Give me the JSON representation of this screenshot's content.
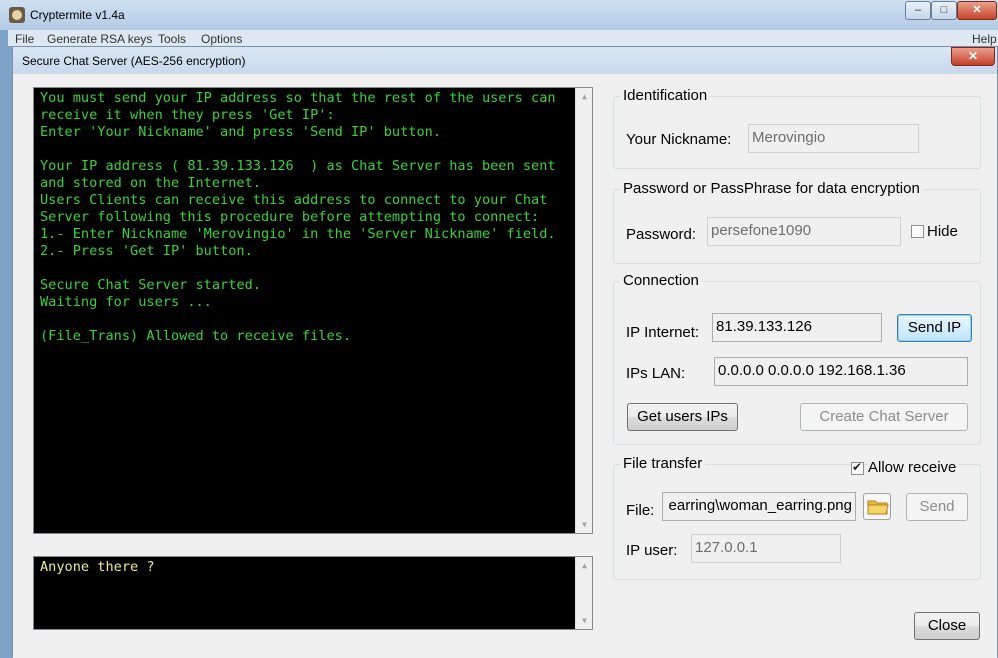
{
  "window": {
    "title": "Cryptermite v1.4a",
    "minimize_glyph": "–",
    "maximize_glyph": "□",
    "close_glyph": "✕"
  },
  "menu": {
    "items": [
      "File",
      "Generate RSA keys",
      "Tools",
      "Options"
    ],
    "help": "Help"
  },
  "dialog": {
    "title": "Secure Chat Server (AES-256 encryption)",
    "close_glyph": "✕"
  },
  "chat_log": {
    "lines": [
      "You must send your IP address so that the rest of the users can",
      "receive it when they press 'Get IP':",
      "Enter 'Your Nickname' and press 'Send IP' button.",
      "",
      "Your IP address ( 81.39.133.126  ) as Chat Server has been sent",
      "and stored on the Internet.",
      "Users Clients can receive this address to connect to your Chat",
      "Server following this procedure before attempting to connect:",
      "1.- Enter Nickname 'Merovingio' in the 'Server Nickname' field.",
      "2.- Press 'Get IP' button.",
      "",
      "Secure Chat Server started.",
      "Waiting for users ...",
      "",
      "(File_Trans) Allowed to receive files."
    ]
  },
  "message_input": {
    "value": "Anyone there ?"
  },
  "identification": {
    "legend": "Identification",
    "nickname_label": "Your Nickname:",
    "nickname_value": "Merovingio"
  },
  "password": {
    "legend": "Password or PassPhrase for data encryption",
    "label": "Password:",
    "value": "persefone1090",
    "hide_label": "Hide",
    "hide_checked": false
  },
  "connection": {
    "legend": "Connection",
    "ip_internet_label": "IP Internet:",
    "ip_internet_value": "81.39.133.126",
    "send_ip_button": "Send IP",
    "ips_lan_label": "IPs LAN:",
    "ips_lan_value": "0.0.0.0  0.0.0.0  192.168.1.36",
    "get_users_ips_button": "Get users IPs",
    "create_chat_server_button": "Create Chat Server"
  },
  "file_transfer": {
    "legend": "File transfer",
    "allow_receive_label": "Allow receive",
    "allow_receive_checked": true,
    "file_label": "File:",
    "file_value": "earring\\woman_earring.png",
    "send_button": "Send",
    "ip_user_label": "IP user:",
    "ip_user_value": "127.0.0.1"
  },
  "footer": {
    "close_button": "Close"
  },
  "colors": {
    "log_text": "#3ad13a",
    "input_text": "#ecec8e",
    "console_bg": "#000000"
  }
}
